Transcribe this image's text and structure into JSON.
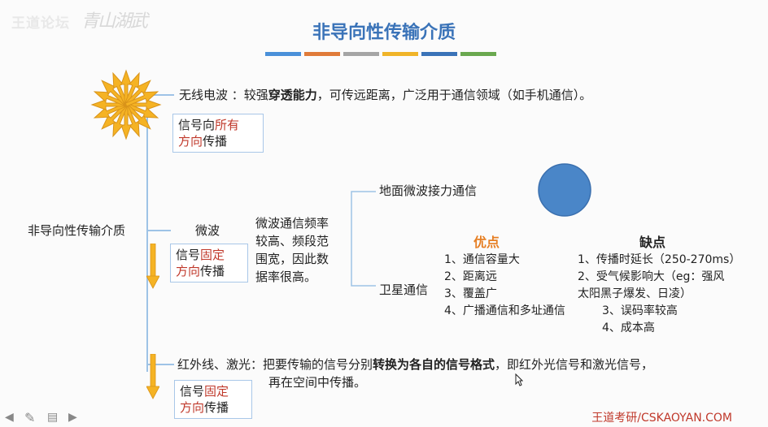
{
  "watermark": {
    "logo": "王道论坛",
    "signature": "青山湖武"
  },
  "slide": {
    "title": "非导向性传输介质",
    "color_bars": [
      "#4a90d9",
      "#e07b39",
      "#a5a5a5",
      "#f0b429",
      "#3a73b8",
      "#6aa84f"
    ],
    "root_label": "非导向性传输介质",
    "radio": {
      "pre": "无线电波 ：较强",
      "bold": "穿透能力",
      "post": "，可传远距离，广泛用于通信领域（如手机通信）。",
      "box_a": "信号向",
      "box_b": "所有",
      "box_c": "方向",
      "box_d": "传播"
    },
    "microwave": {
      "label": "微波",
      "box_a": "信号",
      "box_b": "固定",
      "box_c": "方向",
      "box_d": "传播",
      "desc": [
        "微波通信频率",
        "较高、频段范",
        "围宽，因此数",
        "据率很高。"
      ],
      "ground": "地面微波接力通信",
      "satellite": "卫星通信",
      "adv_title": "优点",
      "advantages": [
        "1、通信容量大",
        "2、距离远",
        "3、覆盖广",
        "4、广播通信和多址通信"
      ],
      "dis_title": "缺点",
      "disadvantages": [
        "1、传播时延长（250-270ms）",
        "2、受气候影响大（eg：强风",
        "太阳黑子爆发、日凌）",
        "3、误码率较高",
        "4、成本高"
      ]
    },
    "infrared": {
      "pre": "红外线、激光：把要传输的信号分别",
      "bold": "转换为各自的信号格式",
      "post": "，即红外光信号和激光信号，",
      "line2": "再在空间中传播。",
      "box_a": "信号",
      "box_b": "固定",
      "box_c": "方向",
      "box_d": "传播"
    },
    "colors": {
      "arrow": "#f5b324",
      "arrow_stroke": "#d9941a",
      "circle": "#4a86c8",
      "accent_red": "#c0392b",
      "adv": "#e67e22"
    }
  },
  "footer": {
    "brand": "王道考研/CSKAOYAN.COM"
  },
  "controls": {
    "prev": "◀",
    "pen": "✎",
    "menu": "▤",
    "next": "▶"
  }
}
